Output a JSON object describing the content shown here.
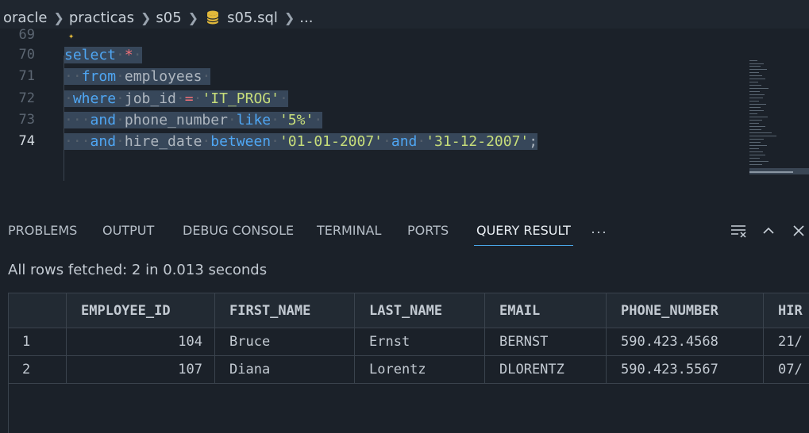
{
  "breadcrumb": {
    "items": [
      "oracle",
      "practicas",
      "s05",
      "s05.sql",
      "..."
    ],
    "file_icon": "database-icon"
  },
  "editor": {
    "lines": [
      {
        "number": "69"
      },
      {
        "number": "70"
      },
      {
        "number": "71"
      },
      {
        "number": "72"
      },
      {
        "number": "73"
      },
      {
        "number": "74"
      }
    ],
    "tokens": {
      "select": "select",
      "star": "*",
      "from": "from",
      "employees": "employees",
      "where": "where",
      "job_id": "job_id",
      "eq": "=",
      "it_prog": "'IT_PROG'",
      "and": "and",
      "phone_number": "phone_number",
      "like": "like",
      "five": "'5%'",
      "hire_date": "hire_date",
      "between": "between",
      "date1": "'01-01-2007'",
      "date2": "'31-12-2007'",
      "semicolon": ";"
    }
  },
  "panel": {
    "tabs": [
      "PROBLEMS",
      "OUTPUT",
      "DEBUG CONSOLE",
      "TERMINAL",
      "PORTS",
      "QUERY RESULT"
    ],
    "active_tab": "QUERY RESULT",
    "more": "···",
    "status": "All rows fetched: 2 in 0.013 seconds"
  },
  "results": {
    "columns": [
      "",
      "EMPLOYEE_ID",
      "FIRST_NAME",
      "LAST_NAME",
      "EMAIL",
      "PHONE_NUMBER",
      "HIR"
    ],
    "rows": [
      [
        "1",
        "104",
        "Bruce",
        "Ernst",
        "BERNST",
        "590.423.4568",
        "21/"
      ],
      [
        "2",
        "107",
        "Diana",
        "Lorentz",
        "DLORENTZ",
        "590.423.5567",
        "07/"
      ]
    ]
  },
  "colors": {
    "background": "#1b2129",
    "keyword": "#4fa6f3",
    "string": "#c7dd7a",
    "operator": "#f07178",
    "selection": "#37475a",
    "active_tab_underline": "#4aa6e8"
  }
}
